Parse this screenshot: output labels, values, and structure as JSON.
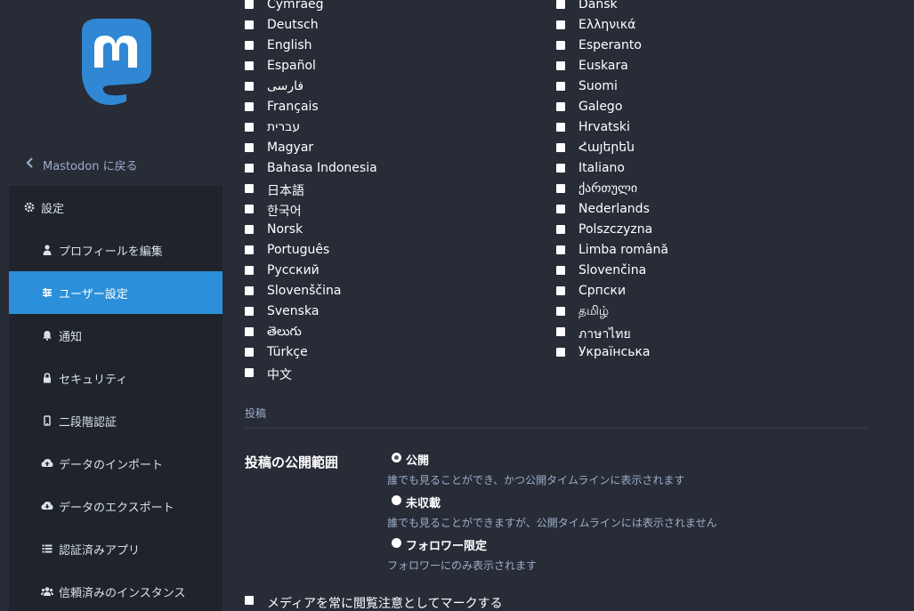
{
  "sidebar": {
    "back_label": "Mastodon に戻る",
    "settings_label": "設定",
    "items": [
      {
        "label": "プロフィールを編集",
        "icon": "user-icon"
      },
      {
        "label": "ユーザー設定",
        "icon": "sliders-icon",
        "active": true
      },
      {
        "label": "通知",
        "icon": "bell-icon"
      },
      {
        "label": "セキュリティ",
        "icon": "lock-icon"
      },
      {
        "label": "二段階認証",
        "icon": "mobile-icon"
      },
      {
        "label": "データのインポート",
        "icon": "cloud-upload-icon"
      },
      {
        "label": "データのエクスポート",
        "icon": "cloud-download-icon"
      },
      {
        "label": "認証済みアプリ",
        "icon": "list-icon"
      },
      {
        "label": "信頼済みのインスタンス",
        "icon": "users-icon"
      }
    ]
  },
  "languages": {
    "left": [
      "Cymraeg",
      "Deutsch",
      "English",
      "Español",
      "فارسی",
      "Français",
      "עברית",
      "Magyar",
      "Bahasa Indonesia",
      "日本語",
      "한국어",
      "Norsk",
      "Português",
      "Русский",
      "Slovenščina",
      "Svenska",
      "తెలుగు",
      "Türkçe",
      "中文"
    ],
    "right": [
      "Dansk",
      "Ελληνικά",
      "Esperanto",
      "Euskara",
      "Suomi",
      "Galego",
      "Hrvatski",
      "Հայերեն",
      "Italiano",
      "ქართული",
      "Nederlands",
      "Polszczyzna",
      "Limba română",
      "Slovenčina",
      "Српски",
      "தமிழ்",
      "ภาษาไทย",
      "Українська"
    ]
  },
  "posting": {
    "section_title": "投稿",
    "privacy_label": "投稿の公開範囲",
    "options": [
      {
        "label": "公開",
        "hint": "誰でも見ることができ、かつ公開タイムラインに表示されます",
        "checked": true
      },
      {
        "label": "未収載",
        "hint": "誰でも見ることができますが、公開タイムラインには表示されません",
        "checked": false
      },
      {
        "label": "フォロワー限定",
        "hint": "フォロワーにのみ表示されます",
        "checked": false
      }
    ],
    "media_sensitive_label": "メディアを常に閲覧注意としてマークする"
  },
  "colors": {
    "accent": "#2b90d9",
    "background": "#282c37",
    "sidebar_group": "#1f232b",
    "muted_text": "#9baec8",
    "logo": "#3088d4"
  }
}
